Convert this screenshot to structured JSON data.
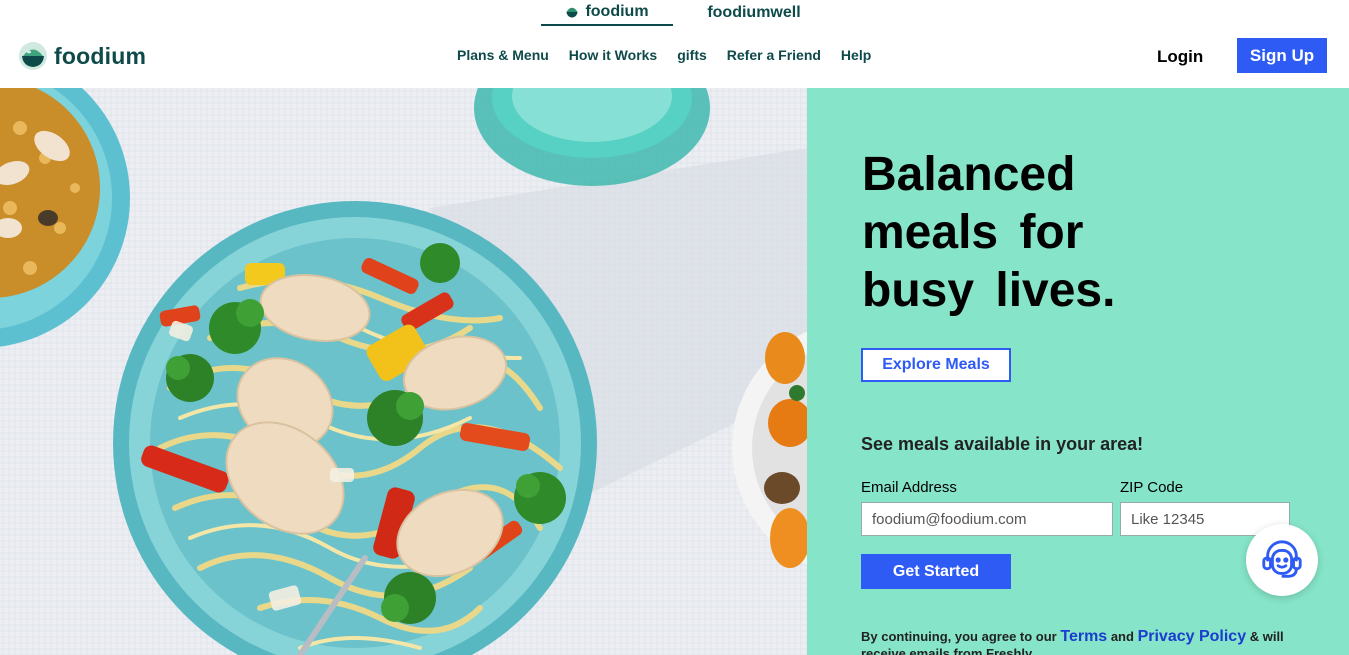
{
  "brand_switcher": {
    "tabs": [
      {
        "label": "foodium",
        "active": true
      },
      {
        "label": "foodiumwell",
        "active": false
      }
    ]
  },
  "header": {
    "logo_text": "foodium",
    "nav": [
      {
        "label": "Plans & Menu"
      },
      {
        "label": "How it Works"
      },
      {
        "label": "gifts"
      },
      {
        "label": "Refer a Friend"
      },
      {
        "label": "Help"
      }
    ],
    "login_label": "Login",
    "signup_label": "Sign Up"
  },
  "hero": {
    "headline_lines": [
      "Balanced",
      "meals for",
      "busy lives."
    ],
    "explore_label": "Explore Meals",
    "area_title": "See meals available in your area!",
    "email_label": "Email Address",
    "email_placeholder": "foodium@foodium.com",
    "zip_label": "ZIP Code",
    "zip_placeholder": "Like 12345",
    "cta_label": "Get Started",
    "legal": {
      "prefix": "By continuing, you agree to our",
      "terms_label": "Terms",
      "and": "and",
      "privacy_label": "Privacy Policy",
      "suffix": "& will receive emails from Freshly"
    }
  },
  "colors": {
    "brand_dark": "#0f4a4a",
    "accent_blue": "#2f5bf5",
    "panel_mint": "#86e5c8"
  },
  "icons": {
    "logo": "bowl-icon",
    "chat": "support-agent-icon"
  }
}
